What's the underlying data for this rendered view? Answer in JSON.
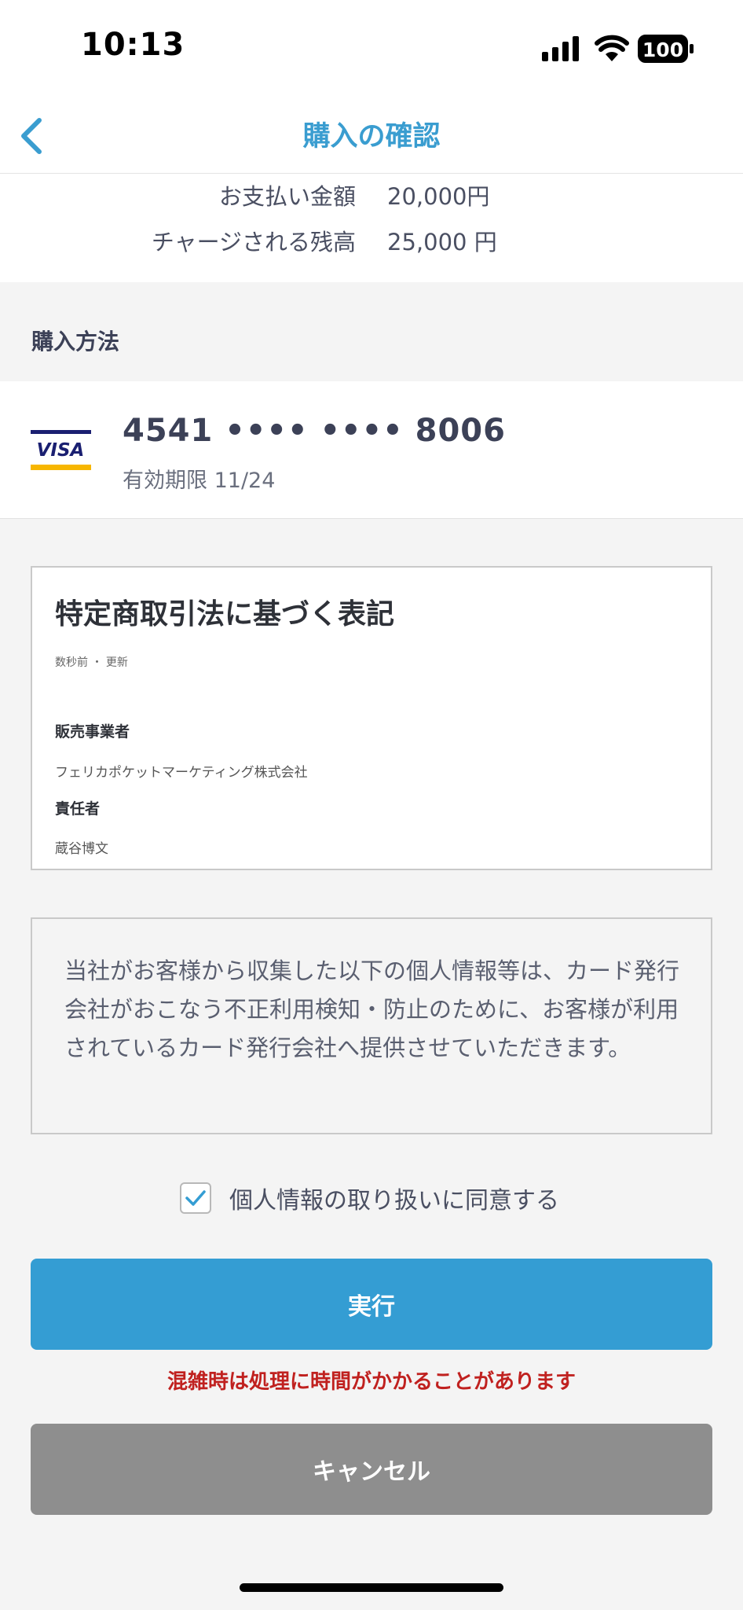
{
  "status_bar": {
    "time": "10:13",
    "battery": "100"
  },
  "nav": {
    "title": "購入の確認"
  },
  "amounts": [
    {
      "label": "お支払い金額",
      "value": "20,000円"
    },
    {
      "label": "チャージされる残高",
      "value": "25,000 円"
    }
  ],
  "purchase_method": {
    "section_title": "購入方法",
    "card": {
      "brand": "VISA",
      "number": "4541 •••• •••• 8006",
      "expiry": "有効期限 11/24"
    }
  },
  "legal": {
    "title": "特定商取引法に基づく表記",
    "updated": "数秒前 ・ 更新",
    "items": [
      {
        "heading": "販売事業者",
        "text": "フェリカポケットマーケティング株式会社"
      },
      {
        "heading": "責任者",
        "text": "蔵谷博文"
      }
    ]
  },
  "notice": {
    "text": "当社がお客様から収集した以下の個人情報等は、カード発行会社がおこなう不正利用検知・防止のために、お客様が利用されているカード発行会社へ提供させていただきます。"
  },
  "agree": {
    "label": "個人情報の取り扱いに同意する",
    "checked": true
  },
  "buttons": {
    "execute": "実行",
    "warning": "混雑時は処理に時間がかかることがあります",
    "cancel": "キャンセル"
  },
  "colors": {
    "accent": "#349dd3",
    "title_blue": "#3a9dd0",
    "warning_red": "#c0211f",
    "cancel_gray": "#8e8e8e"
  }
}
